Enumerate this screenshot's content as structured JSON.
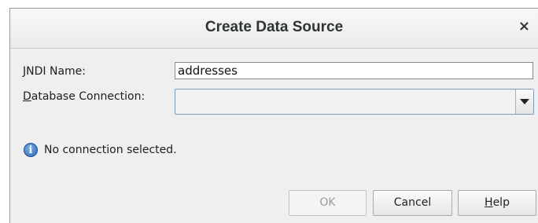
{
  "dialog": {
    "title": "Create Data Source",
    "close_symbol": "×"
  },
  "form": {
    "jndi_label_mnemonic": "J",
    "jndi_label_rest": "NDI Name:",
    "jndi_value": "addresses",
    "db_label_mnemonic": "D",
    "db_label_rest": "atabase Connection:",
    "db_value": ""
  },
  "info": {
    "icon": "info-icon",
    "message": "No connection selected."
  },
  "buttons": {
    "ok": "OK",
    "cancel": "Cancel",
    "help_mnemonic": "H",
    "help_rest": "elp"
  }
}
